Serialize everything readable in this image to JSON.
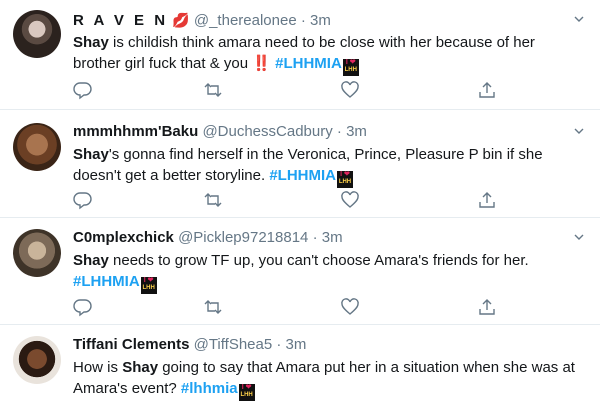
{
  "tweets": [
    {
      "name": "R A V E N",
      "name_emoji": "💋",
      "handle": "@_therealonee",
      "separator": "·",
      "time": "3m",
      "segments": [
        {
          "t": "b",
          "v": "Shay"
        },
        {
          "t": "p",
          "v": " is childish think amara need to be close with her because of her brother girl fuck that & you "
        },
        {
          "t": "bang",
          "v": "‼️"
        },
        {
          "t": "p",
          "v": " "
        },
        {
          "t": "tag",
          "v": "#LHHMIA"
        },
        {
          "t": "badge"
        }
      ]
    },
    {
      "name": "mmmhhmm'Baku",
      "handle": "@DuchessCadbury",
      "separator": "·",
      "time": "3m",
      "segments": [
        {
          "t": "b",
          "v": "Shay"
        },
        {
          "t": "p",
          "v": "'s gonna find herself in the Veronica, Prince, Pleasure P bin if she doesn't get a better storyline. "
        },
        {
          "t": "tag",
          "v": "#LHHMIA"
        },
        {
          "t": "badge"
        }
      ]
    },
    {
      "name": "C0mplexchick",
      "handle": "@Picklep97218814",
      "separator": "·",
      "time": "3m",
      "segments": [
        {
          "t": "b",
          "v": "Shay"
        },
        {
          "t": "p",
          "v": " needs to grow TF up, you can't choose Amara's friends for her. "
        },
        {
          "t": "tag",
          "v": "#LHHMIA"
        },
        {
          "t": "badge"
        }
      ]
    },
    {
      "name": "Tiffani Clements",
      "handle": "@TiffShea5",
      "separator": "·",
      "time": "3m",
      "segments": [
        {
          "t": "p",
          "v": "How is "
        },
        {
          "t": "b",
          "v": "Shay"
        },
        {
          "t": "p",
          "v": " going to say that Amara put her in a situation when she was at Amara's event? "
        },
        {
          "t": "tag",
          "v": "#lhhmia"
        },
        {
          "t": "badge"
        }
      ]
    }
  ],
  "badge": {
    "top": "I ❤",
    "bottom": "LHH"
  },
  "icons": {
    "reply": "reply-icon",
    "retweet": "retweet-icon",
    "like": "heart-icon",
    "share": "share-icon",
    "menu": "chevron-down-icon"
  },
  "colors": {
    "link": "#1da1f2",
    "muted": "#657786",
    "text": "#14171a",
    "divider": "#e6ecf0"
  }
}
